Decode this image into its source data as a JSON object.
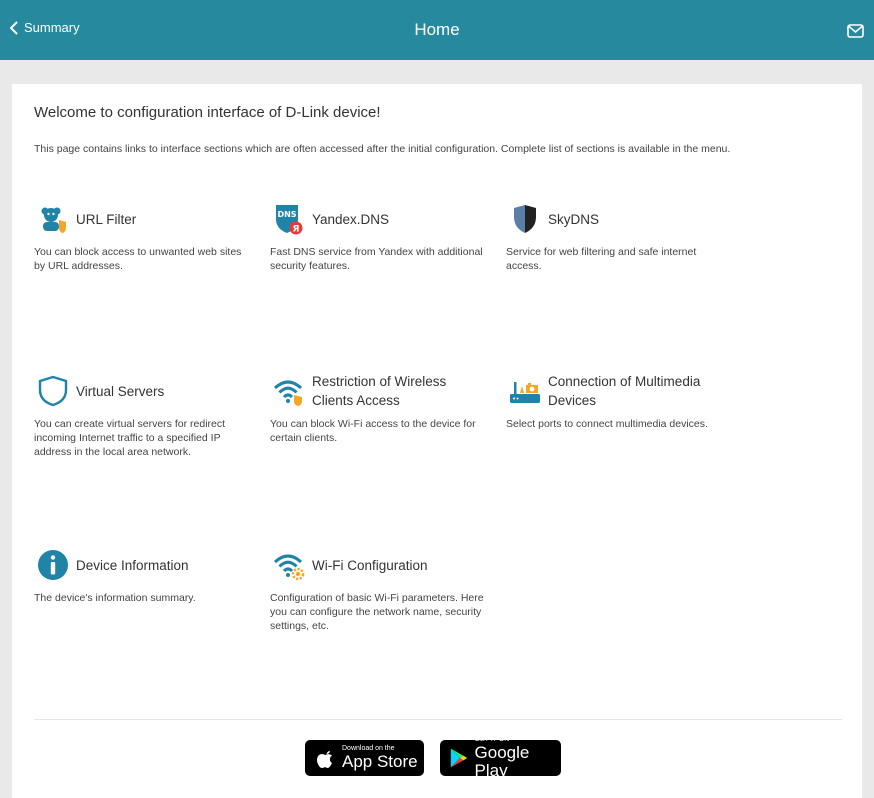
{
  "header": {
    "back_label": "Summary",
    "title": "Home",
    "icons": {
      "back": "chevron-left-icon",
      "mail": "mail-icon"
    }
  },
  "main": {
    "welcome": "Welcome to configuration interface of D-Link device!",
    "description": "This page contains links to interface sections which are often accessed after the initial configuration. Complete list of sections is available in the menu.",
    "tiles": [
      {
        "title": "URL Filter",
        "text": "You can block access to unwanted web sites by URL addresses.",
        "icon": "url-filter-icon"
      },
      {
        "title": "Yandex.DNS",
        "text": "Fast DNS service from Yandex with additional security features.",
        "icon": "yandex-dns-icon"
      },
      {
        "title": "SkyDNS",
        "text": "Service for web filtering and safe internet access.",
        "icon": "skydns-shield-icon"
      },
      {
        "title": "Virtual Servers",
        "text": "You can create virtual servers for redirect incoming Internet traffic to a specified IP address in the local area network.",
        "icon": "shield-outline-icon"
      },
      {
        "title": "Restriction of Wireless Clients Access",
        "text": "You can block Wi-Fi access to the device for certain clients.",
        "icon": "wifi-shield-icon"
      },
      {
        "title": "Connection of Multimedia Devices",
        "text": "Select ports to connect multimedia devices.",
        "icon": "multimedia-router-icon"
      },
      {
        "title": "Device Information",
        "text": "The device's information summary.",
        "icon": "info-icon"
      },
      {
        "title": "Wi-Fi Configuration",
        "text": "Configuration of basic Wi-Fi parameters. Here you can configure the network name, security settings, etc.",
        "icon": "wifi-gear-icon"
      }
    ]
  },
  "footer": {
    "app_store": {
      "small": "Download on the",
      "big": "App Store",
      "icon": "apple-icon"
    },
    "google_play": {
      "small": "GET IT ON",
      "big": "Google Play",
      "icon": "play-icon"
    }
  },
  "colors": {
    "header_bg": "#26899e",
    "icon_blue": "#1f84a8",
    "icon_orange": "#f5a623",
    "background": "#e9e9e9"
  }
}
